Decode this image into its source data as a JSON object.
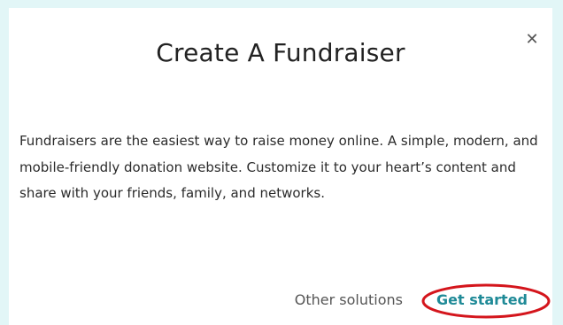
{
  "modal": {
    "title": "Create A Fundraiser",
    "close_icon": "close-icon",
    "body": "Fundraisers are the easiest way to raise money online. A simple, modern, and mobile-friendly donation website. Customize it to your heart’s content and share with your friends, family, and networks.",
    "other_solutions_label": "Other solutions",
    "get_started_label": "Get started"
  },
  "colors": {
    "background": "#e2f6f7",
    "accent": "#1f8a97",
    "highlight": "#d4151c"
  }
}
